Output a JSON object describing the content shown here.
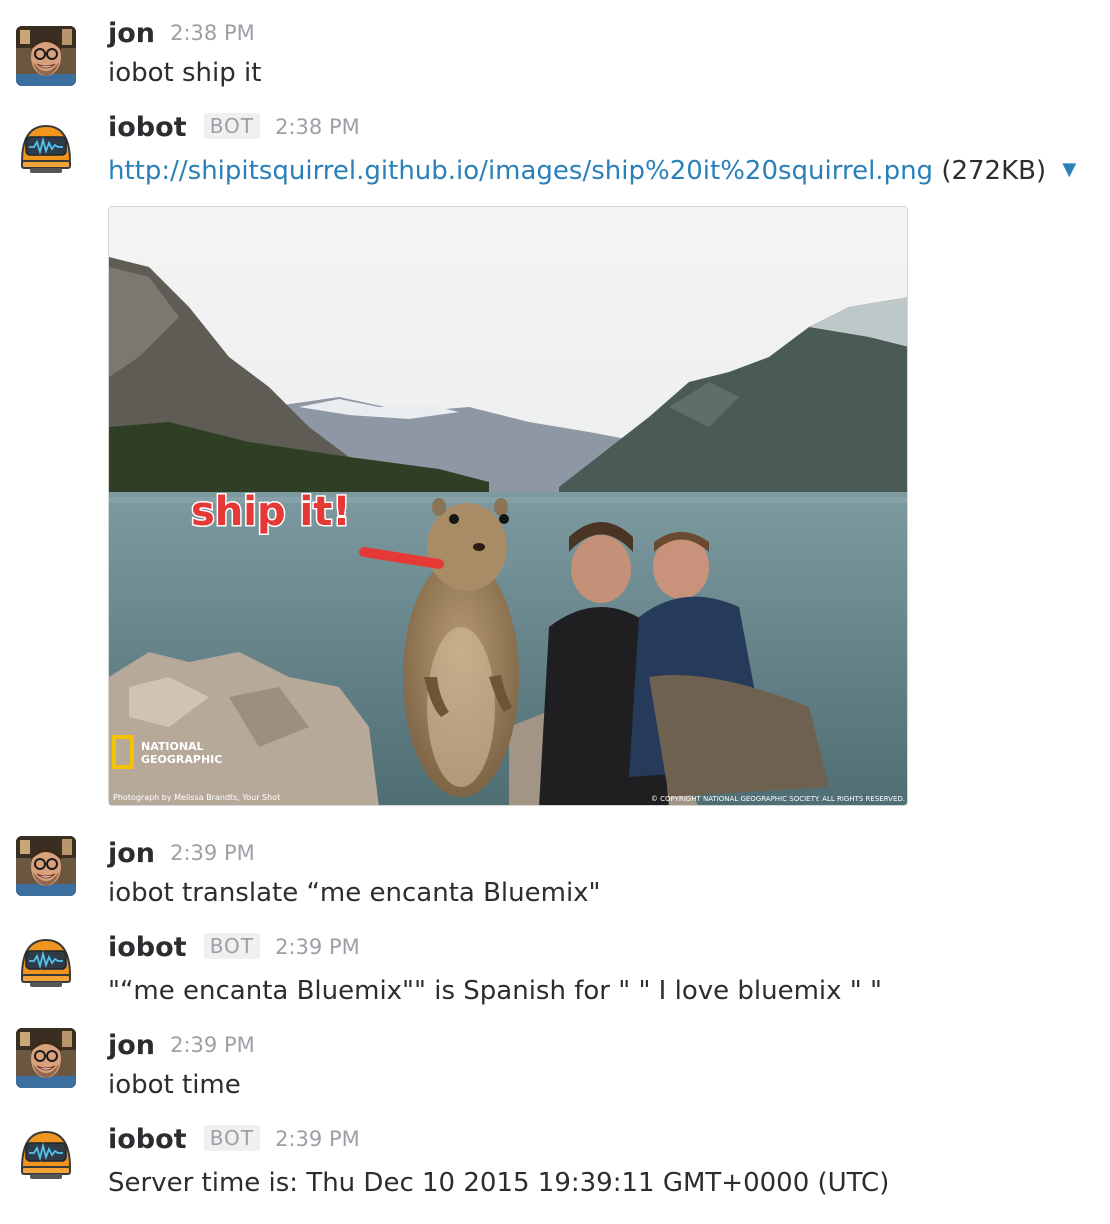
{
  "messages": [
    {
      "author": "jon",
      "time": "2:38 PM",
      "text": "iobot ship it"
    },
    {
      "author": "iobot",
      "badge": "BOT",
      "time": "2:38 PM",
      "link": "http://shipitsquirrel.github.io/images/ship%20it%20squirrel.png",
      "size": "(272KB)",
      "image": {
        "overlay_text": "ship it!",
        "logo_lines": [
          "NATIONAL",
          "GEOGRAPHIC"
        ],
        "credit_left": "Photograph by Melissa Brandts, Your Shot",
        "credit_right": "© COPYRIGHT NATIONAL GEOGRAPHIC SOCIETY. ALL RIGHTS RESERVED."
      }
    },
    {
      "author": "jon",
      "time": "2:39 PM",
      "text": "iobot translate “me encanta Bluemix\""
    },
    {
      "author": "iobot",
      "badge": "BOT",
      "time": "2:39 PM",
      "text": "\"“me encanta Bluemix\"\" is Spanish for \" \" I love bluemix \" \""
    },
    {
      "author": "jon",
      "time": "2:39 PM",
      "text": "iobot time"
    },
    {
      "author": "iobot",
      "badge": "BOT",
      "time": "2:39 PM",
      "text": "Server time is: Thu Dec 10 2015 19:39:11 GMT+0000 (UTC)"
    }
  ],
  "icons": {
    "human_avatar": "user-avatar-icon",
    "bot_avatar": "robot-avatar-icon",
    "dropdown": "caret-down-icon"
  },
  "colors": {
    "link": "#2a80b9",
    "timestamp": "#9e9ea6",
    "bot_avatar": "#f0961e",
    "overlay_text": "#e53935"
  }
}
